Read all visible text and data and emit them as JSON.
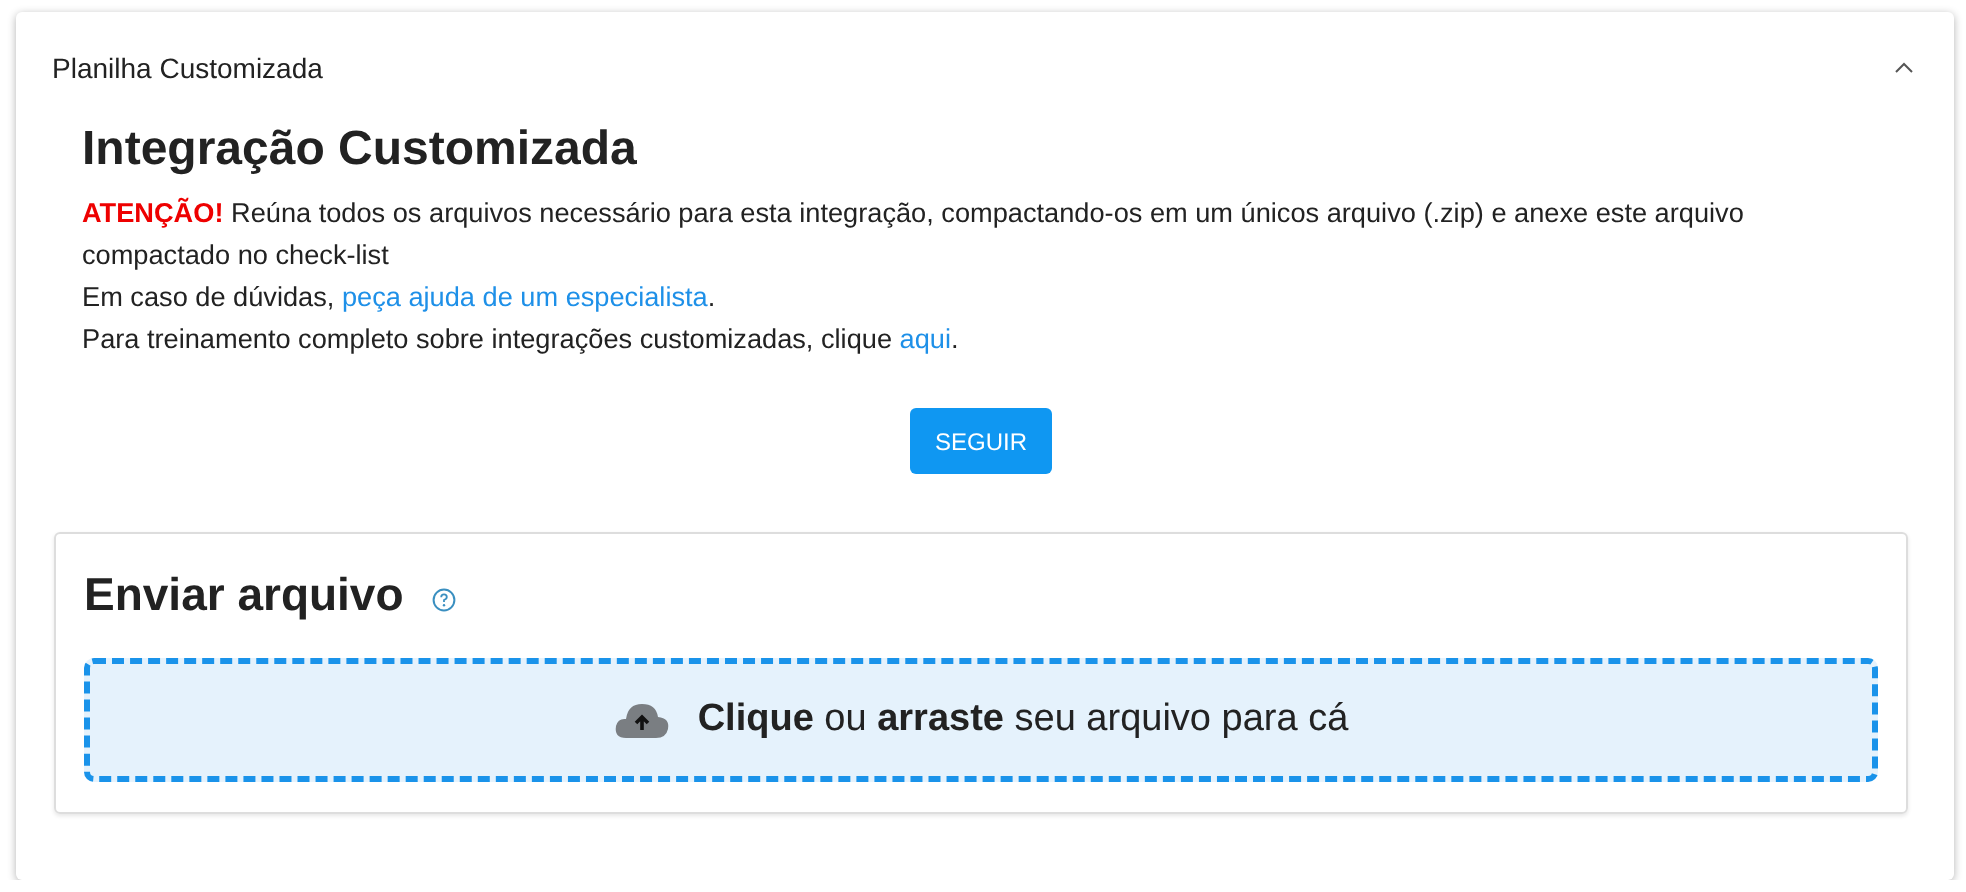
{
  "panel": {
    "title": "Planilha Customizada",
    "expanded": true
  },
  "integration": {
    "title": "Integração Customizada",
    "notice": "**ATENÇÃO!** Reúna todos os arquivos necessário para esta integração, compactando-os em um únicos arquivo (.zip) e anexe este arquivo compactado no check-list",
    "help": {
      "before": "Em caso de dúvidas, ",
      "link": "peça ajuda de um especialista",
      "after": "."
    },
    "training": {
      "before": "Para treinamento completo sobre integrações customizadas, clique ",
      "link": "aqui",
      "after": "."
    },
    "button": "SEGUIR"
  },
  "upload": {
    "title": "Enviar arquivo",
    "dropzone": "**Clique** ou **arraste** seu arquivo para cá"
  }
}
